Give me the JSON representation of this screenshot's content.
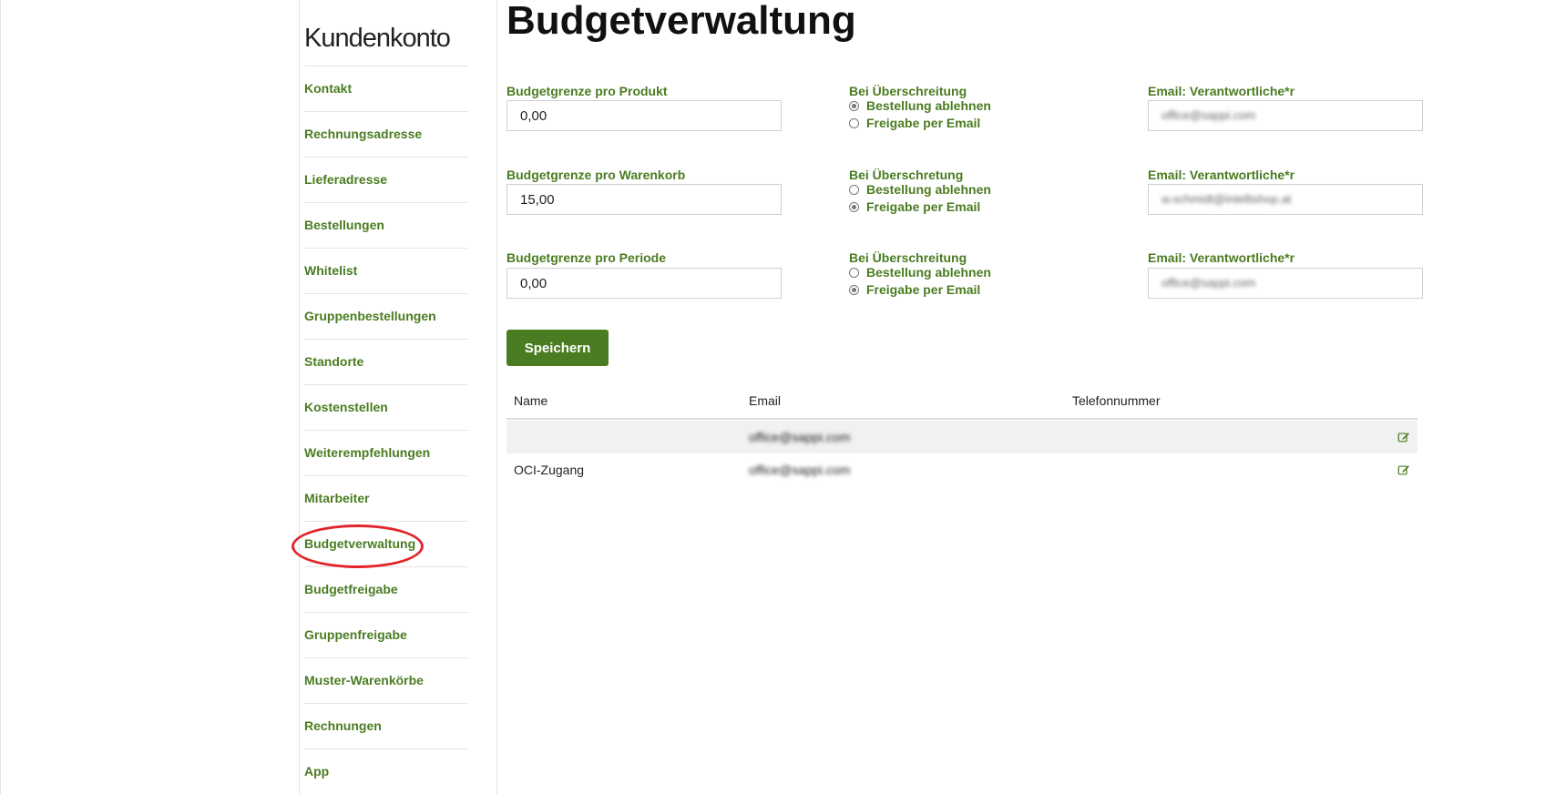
{
  "sidebar": {
    "title": "Kundenkonto",
    "items": [
      {
        "label": "Kontakt"
      },
      {
        "label": "Rechnungsadresse"
      },
      {
        "label": "Lieferadresse"
      },
      {
        "label": "Bestellungen"
      },
      {
        "label": "Whitelist"
      },
      {
        "label": "Gruppenbestellungen"
      },
      {
        "label": "Standorte"
      },
      {
        "label": "Kostenstellen"
      },
      {
        "label": "Weiterempfehlungen"
      },
      {
        "label": "Mitarbeiter"
      },
      {
        "label": "Budgetverwaltung"
      },
      {
        "label": "Budgetfreigabe"
      },
      {
        "label": "Gruppenfreigabe"
      },
      {
        "label": "Muster-Warenkörbe"
      },
      {
        "label": "Rechnungen"
      },
      {
        "label": "App"
      }
    ]
  },
  "page": {
    "title": "Budgetverwaltung"
  },
  "budgets": [
    {
      "label": "Budgetgrenze pro Produkt",
      "value": "0,00",
      "exceed_label": "Bei Überschreitung",
      "option1": "Bestellung ablehnen",
      "option2": "Freigabe per Email",
      "selected": 1,
      "email_label": "Email: Verantwortliche*r",
      "email": "office@sappi.com"
    },
    {
      "label": "Budgetgrenze pro Warenkorb",
      "value": "15,00",
      "exceed_label": "Bei Überschretung",
      "option1": "Bestellung ablehnen",
      "option2": "Freigabe per Email",
      "selected": 2,
      "email_label": "Email: Verantwortliche*r",
      "email": "w.schmidt@intellishop.at"
    },
    {
      "label": "Budgetgrenze pro Periode",
      "value": "0,00",
      "exceed_label": "Bei Überschreitung",
      "option1": "Bestellung ablehnen",
      "option2": "Freigabe per Email",
      "selected": 2,
      "email_label": "Email: Verantwortliche*r",
      "email": "office@sappi.com"
    }
  ],
  "save_label": "Speichern",
  "table": {
    "headers": [
      "Name",
      "Email",
      "Telefonnummer"
    ],
    "rows": [
      {
        "name": "",
        "email": "office@sappi.com",
        "phone": ""
      },
      {
        "name": "OCI-Zugang",
        "email": "office@sappi.com",
        "phone": ""
      }
    ]
  },
  "colors": {
    "accent": "#4a7c21",
    "highlight": "#e3252b"
  }
}
